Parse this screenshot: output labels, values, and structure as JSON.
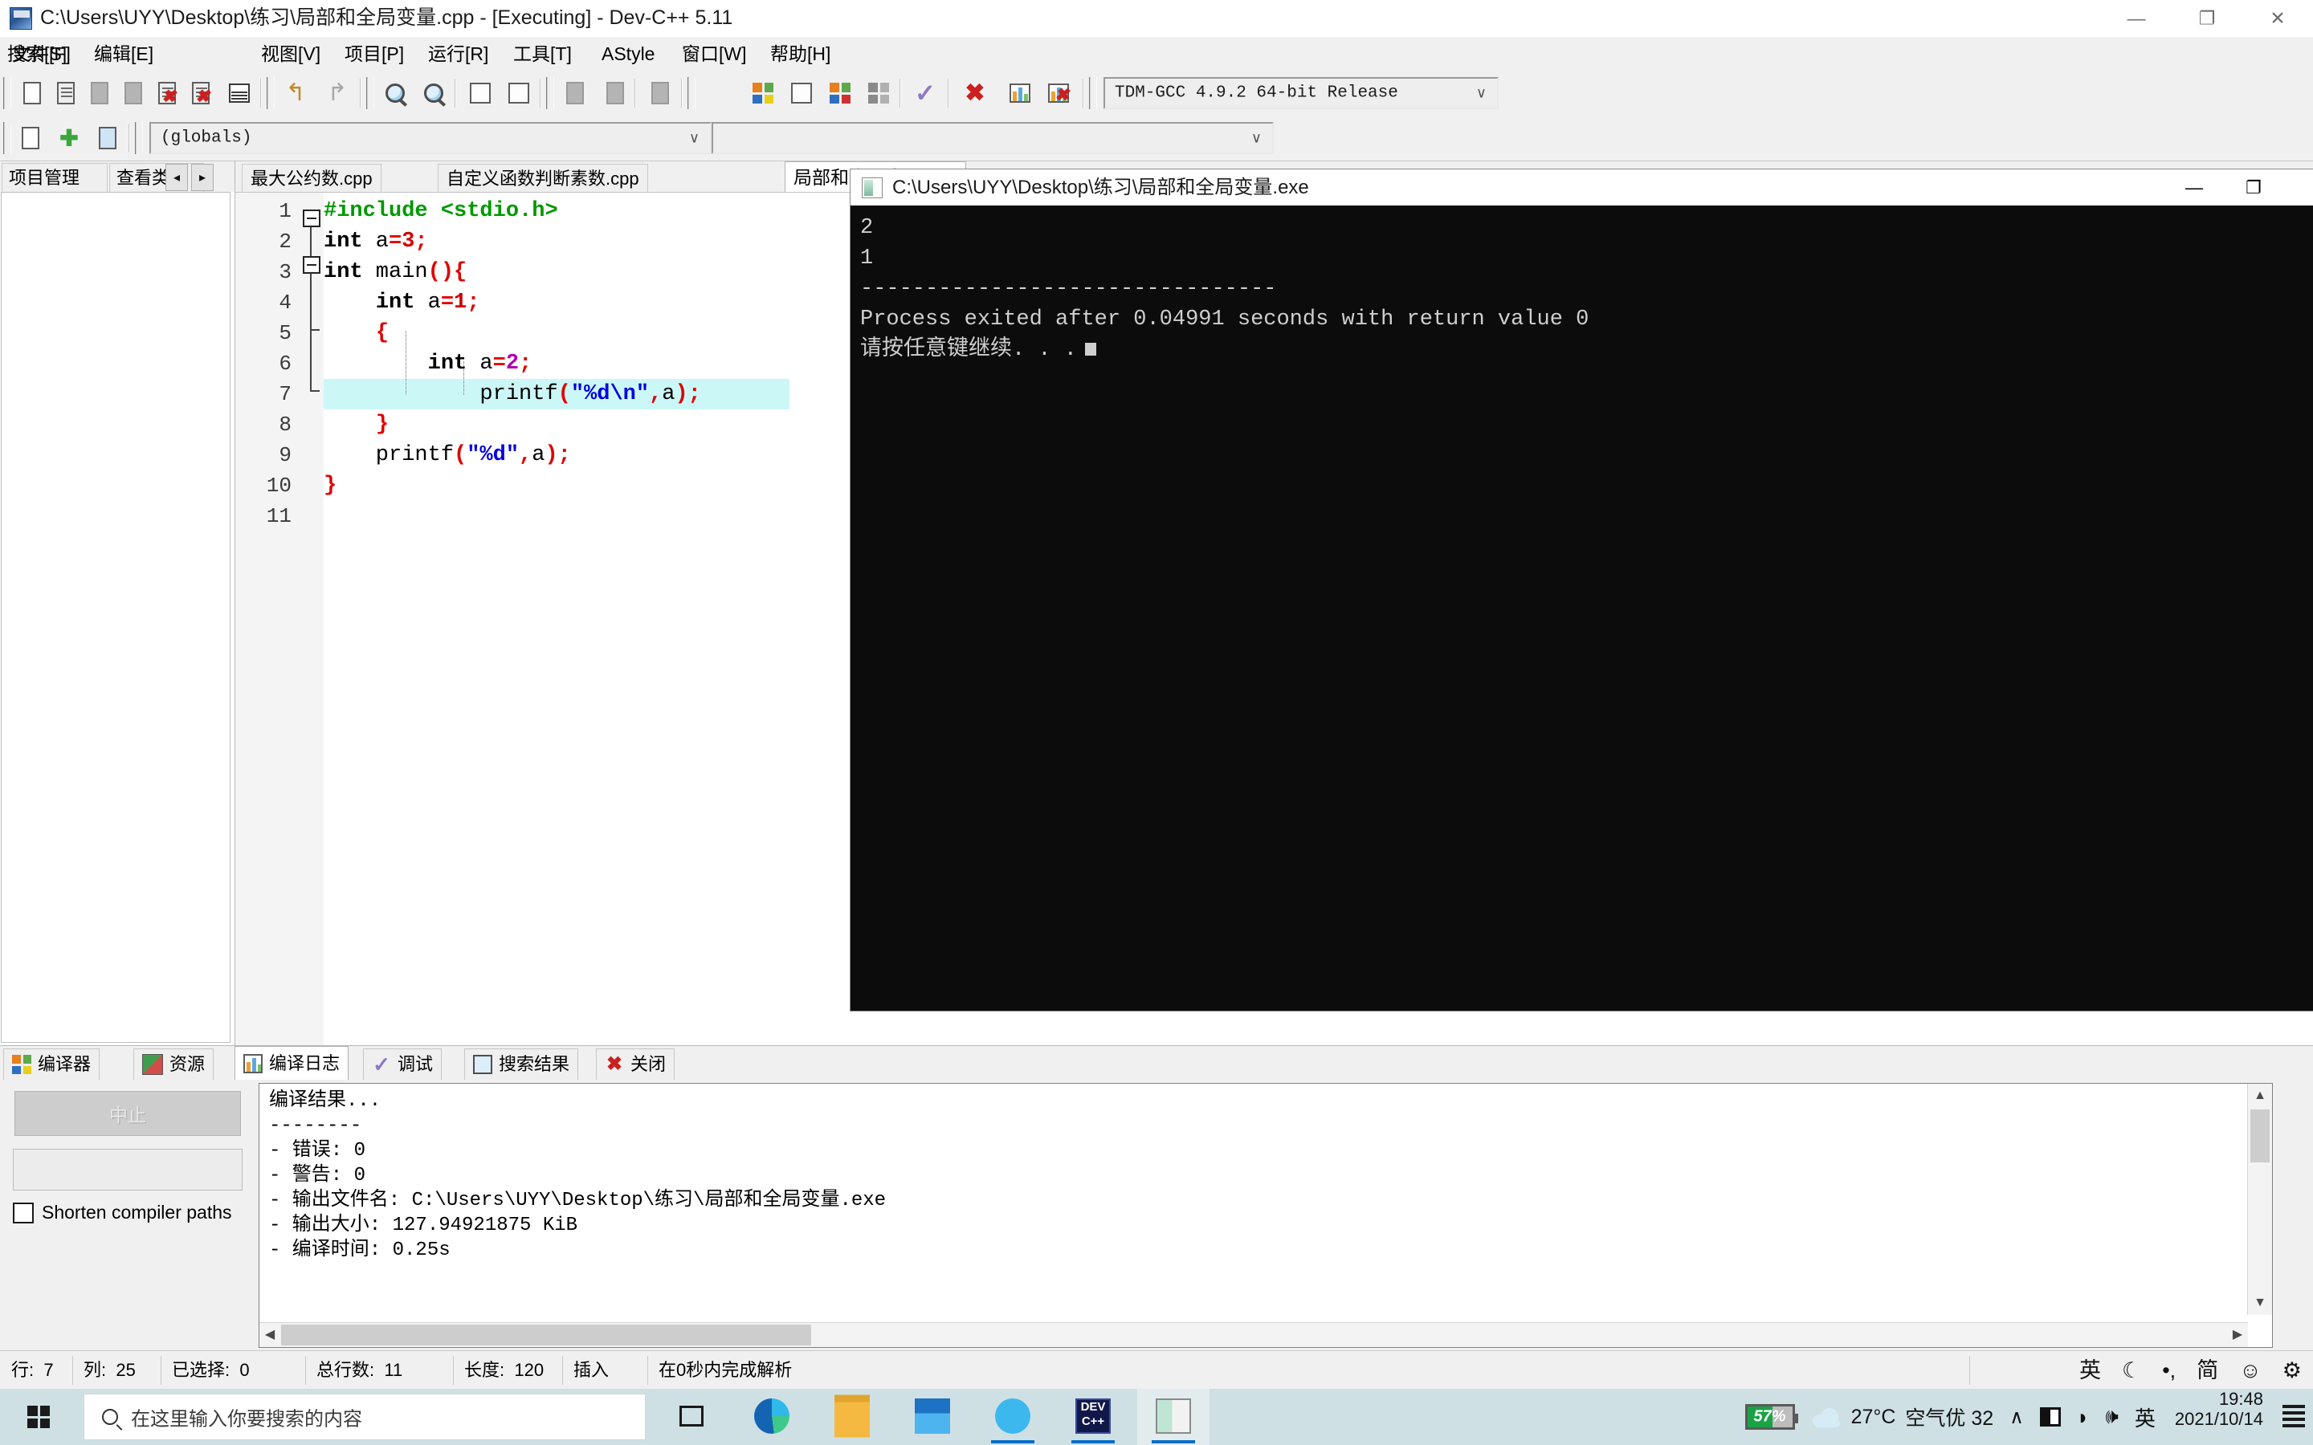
{
  "window": {
    "title": "C:\\Users\\UYY\\Desktop\\练习\\局部和全局变量.cpp - [Executing] - Dev-C++ 5.11",
    "minimize": "—",
    "maximize": "❐",
    "close": "✕"
  },
  "menubar": {
    "items": [
      {
        "label": "文件[F]"
      },
      {
        "label": "编辑[E]"
      },
      {
        "label": "搜索[S]"
      },
      {
        "label": "视图[V]"
      },
      {
        "label": "项目[P]"
      },
      {
        "label": "运行[R]"
      },
      {
        "label": "工具[T]"
      },
      {
        "label": "AStyle"
      },
      {
        "label": "窗口[W]"
      },
      {
        "label": "帮助[H]"
      }
    ]
  },
  "toolbar": {
    "compiler_set": "TDM-GCC 4.9.2 64-bit Release",
    "scope_combo": "(globals)",
    "member_combo": "",
    "dropdown_arrow": "∨"
  },
  "left_panel": {
    "tabs": [
      {
        "label": "项目管理"
      },
      {
        "label": "查看类"
      }
    ],
    "nav_prev": "◂",
    "nav_next": "▸"
  },
  "editor_tabs": [
    {
      "label": "最大公约数.cpp",
      "active": false
    },
    {
      "label": "自定义函数判断素数.cpp",
      "active": false
    },
    {
      "label": "局部和全局变量.cpp",
      "active": true
    }
  ],
  "editor": {
    "line_numbers": [
      "1",
      "2",
      "3",
      "4",
      "5",
      "6",
      "7",
      "8",
      "9",
      "10",
      "11"
    ],
    "highlighted_line": 7,
    "code": [
      {
        "n": 1,
        "tokens": [
          {
            "t": "#include <stdio.h>",
            "c": "pp"
          }
        ]
      },
      {
        "n": 2,
        "tokens": [
          {
            "t": "int",
            "c": "k"
          },
          {
            "t": " a",
            "c": "id"
          },
          {
            "t": "=",
            "c": "pun"
          },
          {
            "t": "3",
            "c": "num2"
          },
          {
            "t": ";",
            "c": "pun"
          }
        ]
      },
      {
        "n": 3,
        "tokens": [
          {
            "t": "int",
            "c": "k"
          },
          {
            "t": " main",
            "c": "id"
          },
          {
            "t": "(){",
            "c": "pun"
          }
        ]
      },
      {
        "n": 4,
        "tokens": [
          {
            "t": "    ",
            "c": "id"
          },
          {
            "t": "int",
            "c": "k"
          },
          {
            "t": " a",
            "c": "id"
          },
          {
            "t": "=",
            "c": "pun"
          },
          {
            "t": "1",
            "c": "num2"
          },
          {
            "t": ";",
            "c": "pun"
          }
        ]
      },
      {
        "n": 5,
        "tokens": [
          {
            "t": "    ",
            "c": "id"
          },
          {
            "t": "{",
            "c": "pun"
          }
        ]
      },
      {
        "n": 6,
        "tokens": [
          {
            "t": "        ",
            "c": "id"
          },
          {
            "t": "int",
            "c": "k"
          },
          {
            "t": " a",
            "c": "id"
          },
          {
            "t": "=",
            "c": "pun"
          },
          {
            "t": "2",
            "c": "num"
          },
          {
            "t": ";",
            "c": "pun"
          }
        ]
      },
      {
        "n": 7,
        "tokens": [
          {
            "t": "            printf",
            "c": "id"
          },
          {
            "t": "(",
            "c": "pun"
          },
          {
            "t": "\"%d\\n\"",
            "c": "str"
          },
          {
            "t": ",",
            "c": "pun"
          },
          {
            "t": "a",
            "c": "id"
          },
          {
            "t": ");",
            "c": "pun"
          }
        ]
      },
      {
        "n": 8,
        "tokens": [
          {
            "t": "    ",
            "c": "id"
          },
          {
            "t": "}",
            "c": "pun"
          }
        ]
      },
      {
        "n": 9,
        "tokens": [
          {
            "t": "    printf",
            "c": "id"
          },
          {
            "t": "(",
            "c": "pun"
          },
          {
            "t": "\"%d\"",
            "c": "str"
          },
          {
            "t": ",",
            "c": "pun"
          },
          {
            "t": "a",
            "c": "id"
          },
          {
            "t": ");",
            "c": "pun"
          }
        ]
      },
      {
        "n": 10,
        "tokens": [
          {
            "t": "}",
            "c": "pun"
          }
        ]
      },
      {
        "n": 11,
        "tokens": []
      }
    ]
  },
  "console": {
    "title": "C:\\Users\\UYY\\Desktop\\练习\\局部和全局变量.exe",
    "minimize": "—",
    "maximize": "❐",
    "lines": [
      "2",
      "1",
      "--------------------------------",
      "Process exited after 0.04991 seconds with return value 0",
      "请按任意键继续. . ."
    ]
  },
  "bottom_panel": {
    "tabs": [
      {
        "label": "编译器",
        "icon": "grid-icon",
        "active": false
      },
      {
        "label": "资源",
        "icon": "resource-icon",
        "active": false
      },
      {
        "label": "编译日志",
        "icon": "chart-icon",
        "active": true
      },
      {
        "label": "调试",
        "icon": "check-icon",
        "active": false
      },
      {
        "label": "搜索结果",
        "icon": "magnifier-icon",
        "active": false
      },
      {
        "label": "关闭",
        "icon": "close-red-icon",
        "active": false
      }
    ],
    "abort_button": "中止",
    "shorten_paths_label": "Shorten compiler paths",
    "shorten_paths_checked": false,
    "log_lines": [
      "编译结果...",
      "--------",
      "- 错误: 0",
      "- 警告: 0",
      "- 输出文件名: C:\\Users\\UYY\\Desktop\\练习\\局部和全局变量.exe",
      "- 输出大小: 127.94921875 KiB",
      "- 编译时间: 0.25s"
    ]
  },
  "status_bar": {
    "cells": [
      {
        "label": "行:",
        "value": "7"
      },
      {
        "label": "列:",
        "value": "25"
      },
      {
        "label": "已选择:",
        "value": "0"
      },
      {
        "label": "总行数:",
        "value": "11"
      },
      {
        "label": "长度:",
        "value": "120"
      },
      {
        "label": "插入",
        "value": ""
      },
      {
        "label": "在0秒内完成解析",
        "value": ""
      }
    ],
    "ime": [
      "英",
      "☾",
      "•,",
      "简",
      "☺",
      "⚙"
    ]
  },
  "taskbar": {
    "search_placeholder": "在这里输入你要搜索的内容",
    "apps": [
      {
        "name": "task-view",
        "running": false,
        "active": false
      },
      {
        "name": "edge",
        "running": false,
        "active": false
      },
      {
        "name": "file-explorer",
        "running": false,
        "active": false
      },
      {
        "name": "mail",
        "running": false,
        "active": false
      },
      {
        "name": "sogou-input",
        "running": true,
        "active": false
      },
      {
        "name": "dev-cpp",
        "running": true,
        "active": false
      },
      {
        "name": "console-window",
        "running": true,
        "active": true
      }
    ],
    "tray": {
      "battery_percent": "57%",
      "battery_level": 57,
      "temperature": "27°C",
      "air_quality": "空气优 32",
      "chevron": "∧",
      "ime_lang": "英",
      "time": "19:48",
      "date": "2021/10/14"
    }
  },
  "colors": {
    "accent": "#0a6ec4",
    "highlight_line": "#ccf7f7",
    "console_bg": "#0c0c0c",
    "taskbar_bg": "#cfe0e4",
    "keyword": "#000000",
    "string": "#0000e0",
    "preproc": "#009900",
    "punct": "#e00000"
  }
}
